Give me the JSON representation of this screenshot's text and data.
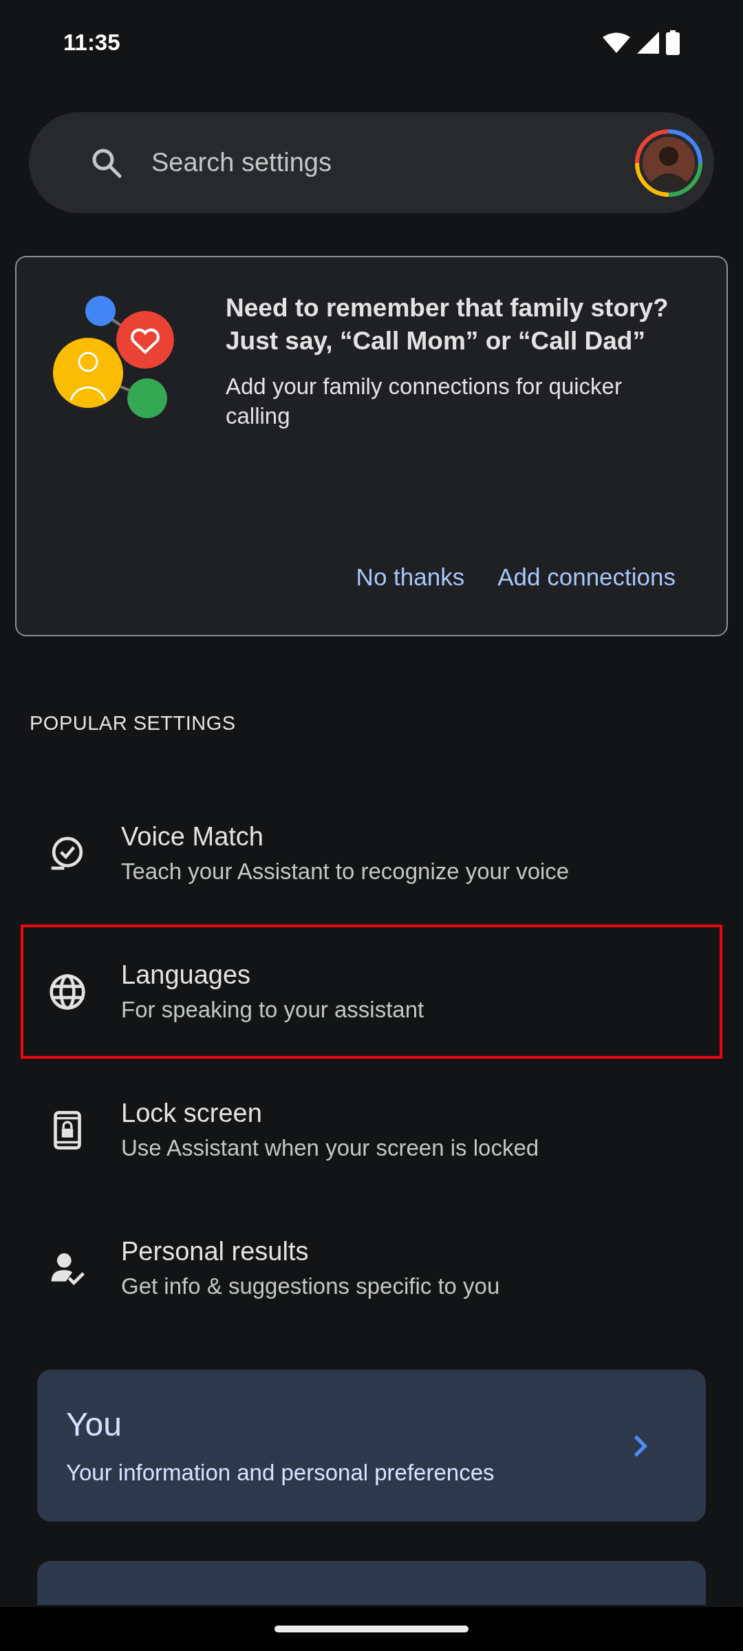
{
  "status_bar": {
    "time": "11:35"
  },
  "search": {
    "placeholder": "Search settings"
  },
  "promo_card": {
    "title": "Need to remember that family story? Just say, “Call Mom” or “Call Dad”",
    "body": "Add your family connections for quicker calling",
    "buttons": [
      "No thanks",
      "Add connections"
    ]
  },
  "section_header": "POPULAR SETTINGS",
  "settings": [
    {
      "kind": "voice",
      "title": "Voice Match",
      "subtitle": "Teach your Assistant to recognize your voice",
      "highlighted": false
    },
    {
      "kind": "globe",
      "title": "Languages",
      "subtitle": "For speaking to your assistant",
      "highlighted": true
    },
    {
      "kind": "lock",
      "title": "Lock screen",
      "subtitle": "Use Assistant when your screen is locked",
      "highlighted": false
    },
    {
      "kind": "person",
      "title": "Personal results",
      "subtitle": "Get info & suggestions specific to you",
      "highlighted": false
    }
  ],
  "category_cards": [
    {
      "kind": "full",
      "title": "You",
      "subtitle": "Your information and personal preferences"
    },
    {
      "kind": "cut"
    }
  ]
}
